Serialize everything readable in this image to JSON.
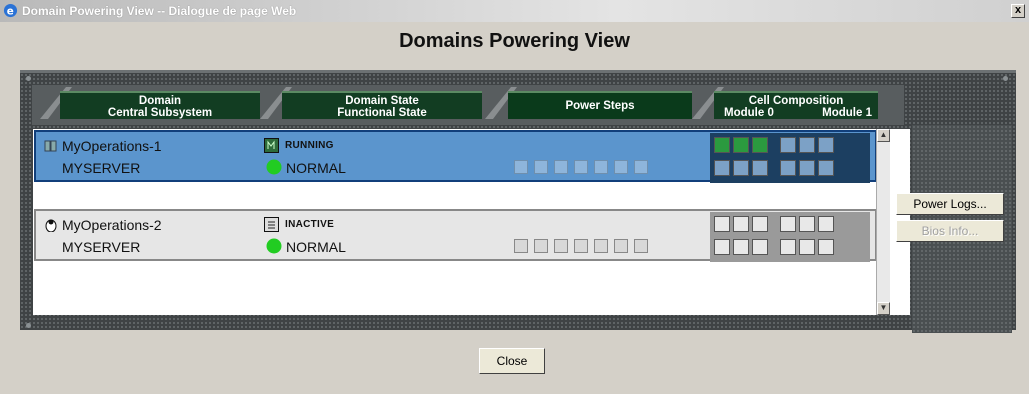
{
  "window": {
    "title": "Domain Powering View -- Dialogue de page Web",
    "close_glyph": "x"
  },
  "dialog": {
    "heading": "Domains Powering View"
  },
  "tabs": [
    {
      "line1": "Domain",
      "line2": "Central Subsystem"
    },
    {
      "line1": "Domain State",
      "line2": "Functional State"
    },
    {
      "line1": "Power Steps",
      "line2": ""
    },
    {
      "line1": "Cell Composition",
      "line2a": "Module 0",
      "line2b": "Module 1"
    }
  ],
  "domains": [
    {
      "name": "MyOperations-1",
      "server": "MYSERVER",
      "state": "RUNNING",
      "functional_state": "NORMAL",
      "selected": true
    },
    {
      "name": "MyOperations-2",
      "server": "MYSERVER",
      "state": "INACTIVE",
      "functional_state": "NORMAL",
      "selected": false
    }
  ],
  "buttons": {
    "power_logs": "Power Logs...",
    "bios_info": "Bios Info...",
    "close": "Close"
  },
  "colors": {
    "selected_row": "#5b95cd",
    "tab_green": "#123d22",
    "status_ok": "#22cc22"
  }
}
